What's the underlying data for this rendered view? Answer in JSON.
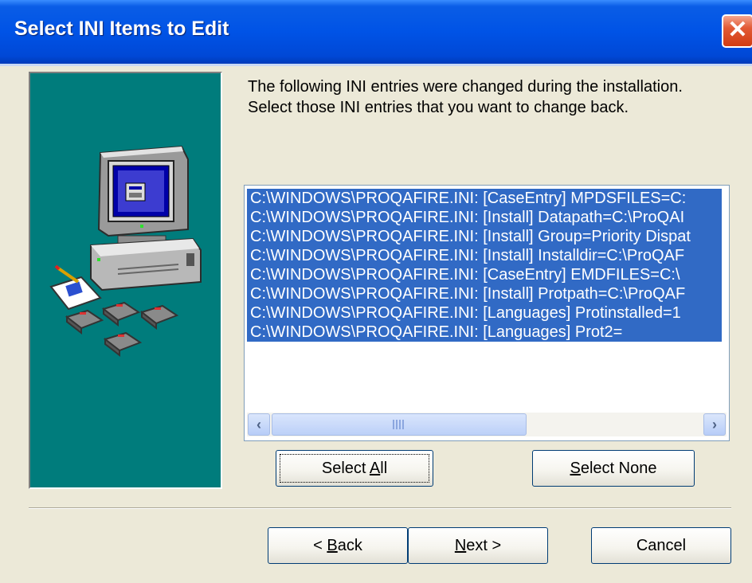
{
  "window": {
    "title": "Select INI Items to Edit",
    "close_glyph": "✕"
  },
  "instructions": {
    "line1": "The following INI entries were changed during the installation.",
    "line2": "Select those INI entries that you want to change back."
  },
  "list": {
    "items": [
      "C:\\WINDOWS\\PROQAFIRE.INI: [CaseEntry] MPDSFILES=C:",
      "C:\\WINDOWS\\PROQAFIRE.INI: [Install] Datapath=C:\\ProQAI",
      "C:\\WINDOWS\\PROQAFIRE.INI: [Install] Group=Priority Dispat",
      "C:\\WINDOWS\\PROQAFIRE.INI: [Install] Installdir=C:\\ProQAF",
      "C:\\WINDOWS\\PROQAFIRE.INI: [CaseEntry] EMDFILES=C:\\",
      "C:\\WINDOWS\\PROQAFIRE.INI: [Install] Protpath=C:\\ProQAF",
      "C:\\WINDOWS\\PROQAFIRE.INI: [Languages] Protinstalled=1",
      "C:\\WINDOWS\\PROQAFIRE.INI: [Languages] Prot2="
    ],
    "scroll_left_glyph": "‹",
    "scroll_right_glyph": "›"
  },
  "buttons": {
    "select_all": {
      "pre": "Select ",
      "key": "A",
      "post": "ll"
    },
    "select_none": {
      "pre": "",
      "key": "S",
      "post": "elect None"
    },
    "back": {
      "pre": "< ",
      "key": "B",
      "post": "ack"
    },
    "next": {
      "pre": "",
      "key": "N",
      "post": "ext >"
    },
    "cancel": "Cancel"
  },
  "colors": {
    "selection": "#316ac5",
    "illustration_bg": "#007c7c",
    "titlebar": "#0053e6"
  }
}
